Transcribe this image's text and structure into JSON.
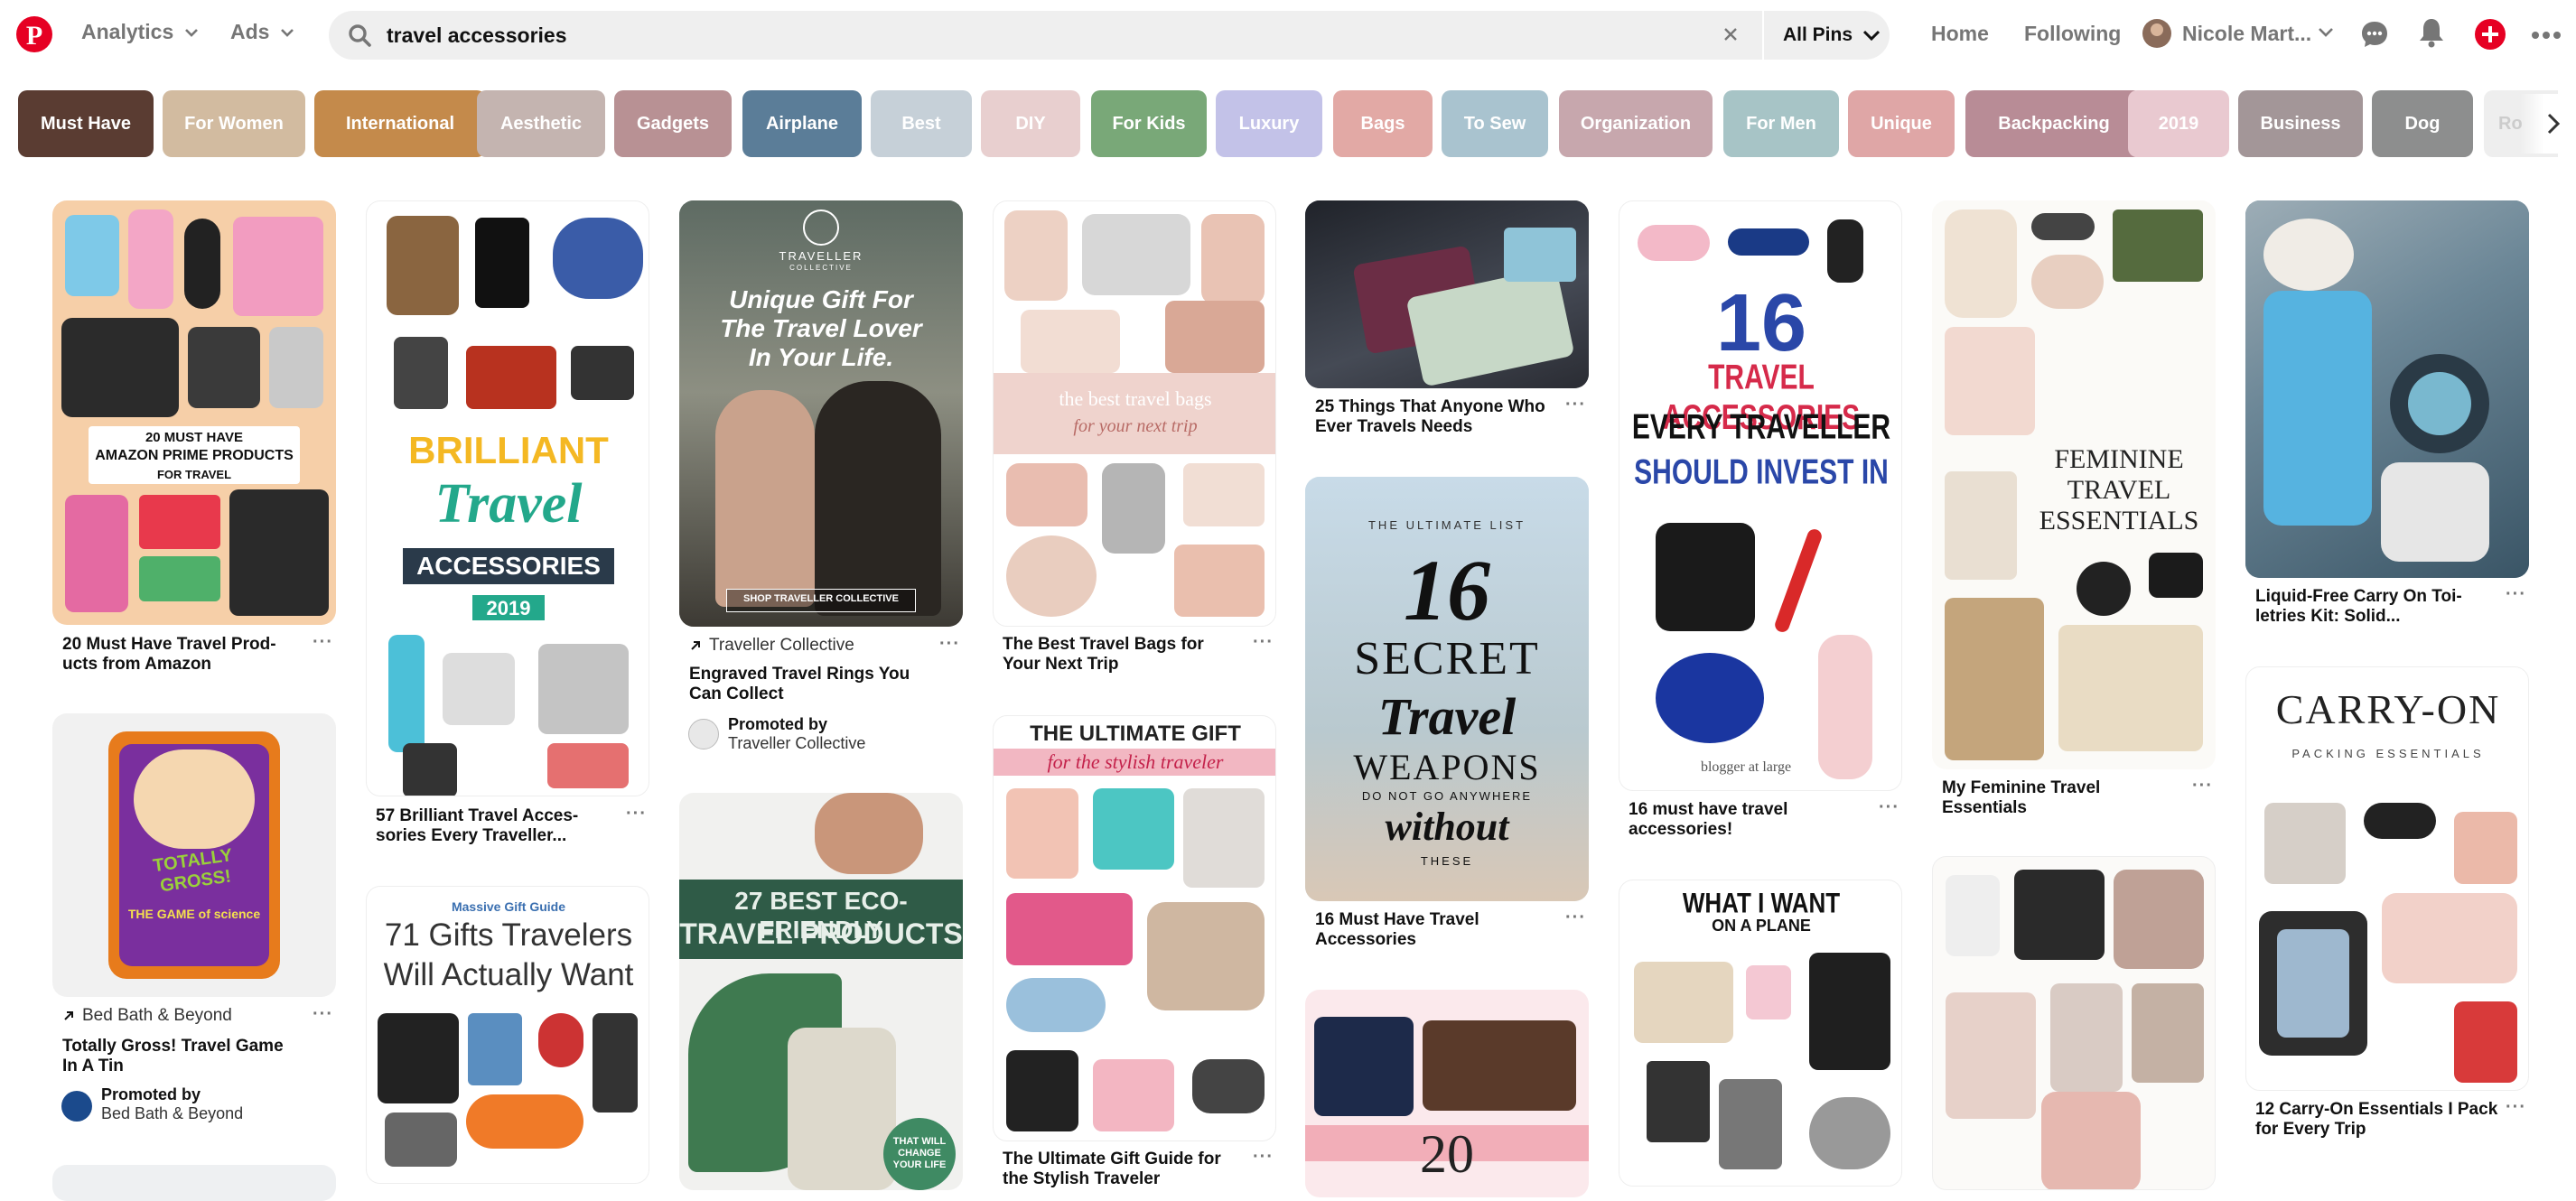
{
  "brand_color": "#e60023",
  "nav": {
    "analytics": "Analytics",
    "ads": "Ads"
  },
  "search": {
    "query": "travel accessories",
    "filter": "All Pins"
  },
  "top": {
    "home": "Home",
    "following": "Following",
    "user": "Nicole Mart..."
  },
  "chips": [
    {
      "label": "Must Have",
      "color": "#5a3c32"
    },
    {
      "label": "For Women",
      "color": "#d2bba0"
    },
    {
      "label": "International",
      "color": "#c48a4b"
    },
    {
      "label": "Aesthetic",
      "color": "#c4b4b0"
    },
    {
      "label": "Gadgets",
      "color": "#b89194"
    },
    {
      "label": "Airplane",
      "color": "#5b7d98"
    },
    {
      "label": "Best",
      "color": "#c6d0d8"
    },
    {
      "label": "DIY",
      "color": "#e8cfcf"
    },
    {
      "label": "For Kids",
      "color": "#79a878"
    },
    {
      "label": "Luxury",
      "color": "#c3c2e8"
    },
    {
      "label": "Bags",
      "color": "#e2a9a5"
    },
    {
      "label": "To Sew",
      "color": "#a9c3cf"
    },
    {
      "label": "Organization",
      "color": "#c7a7ad"
    },
    {
      "label": "For Men",
      "color": "#a7c4c6"
    },
    {
      "label": "Unique",
      "color": "#dfa6a6"
    },
    {
      "label": "Backpacking",
      "color": "#b88c96"
    },
    {
      "label": "2019",
      "color": "#e9c9d0"
    },
    {
      "label": "Business",
      "color": "#a39698"
    },
    {
      "label": "Dog",
      "color": "#8d8e8e"
    },
    {
      "label": "Ro",
      "color": "#eeeeee"
    }
  ],
  "pins": {
    "amazon": {
      "title": "20 Must Have Travel Prod- ucts from Amazon",
      "img_l1": "20 MUST HAVE",
      "img_l2": "AMAZON PRIME PRODUCTS",
      "img_l3": "FOR TRAVEL"
    },
    "game": {
      "source": "Bed Bath & Beyond",
      "title": "Totally Gross! Travel Game In A Tin",
      "promoted": "Promoted by",
      "advertiser": "Bed Bath & Beyond",
      "img_l1": "TOTALLY GROSS!",
      "img_l2": "THE GAME of science"
    },
    "brilliant": {
      "title": "57 Brilliant Travel Acces- sories Every Traveller...",
      "img_l1": "BRILLIANT",
      "img_l2": "Travel",
      "img_l3": "ACCESSORIES",
      "img_l4": "2019"
    },
    "gifts71": {
      "img_l0": "Massive Gift Guide",
      "img_l1": "71 Gifts Travelers",
      "img_l2": "Will Actually Want"
    },
    "rings": {
      "source": "Traveller Collective",
      "title": "Engraved Travel Rings You Can Collect",
      "promoted": "Promoted by",
      "advertiser": "Traveller Collective",
      "img_brand": "TRAVELLER",
      "img_sub": "COLLECTIVE",
      "img_l1": "Unique Gift For",
      "img_l2": "The Travel Lover",
      "img_l3": "In Your Life.",
      "img_btn": "SHOP TRAVELLER COLLECTIVE"
    },
    "eco": {
      "img_l1": "27 BEST ECO-FRIENDLY",
      "img_l2": "TRAVEL PRODUCTS",
      "img_badge": "THAT WILL CHANGE YOUR LIFE"
    },
    "bags": {
      "title": "The Best Travel Bags for Your Next Trip",
      "img_l1": "the best travel bags",
      "img_l2": "for your next trip"
    },
    "giftguide": {
      "title": "The Ultimate Gift Guide for the Stylish Traveler",
      "img_l1": "THE ULTIMATE GIFT GUIDE",
      "img_l2": "for the stylish traveler"
    },
    "things25": {
      "title": "25 Things That Anyone Who Ever Travels Needs"
    },
    "secret16": {
      "title": "16 Must Have Travel Accessories",
      "img_l0": "THE ULTIMATE LIST",
      "img_l1": "16",
      "img_l2": "SECRET",
      "img_l3": "Travel",
      "img_l4": "WEAPONS",
      "img_l5": "DO NOT GO ANYWHERE",
      "img_l6": "without",
      "img_l7": "THESE"
    },
    "twenty": {
      "img_l1": "20"
    },
    "every16": {
      "title": "16 must have travel accessories!",
      "img_l1": "16",
      "img_l2": "TRAVEL ACCESSORIES",
      "img_l3": "EVERY TRAVELLER",
      "img_l4": "SHOULD INVEST IN",
      "img_credit": "blogger at large"
    },
    "plane": {
      "img_l1": "WHAT I WANT",
      "img_l2": "ON A PLANE"
    },
    "feminine": {
      "title": "My Feminine Travel Essentials",
      "img_l1": "FEMININE",
      "img_l2": "TRAVEL",
      "img_l3": "ESSENTIALS"
    },
    "liquid": {
      "title": "Liquid-Free Carry On Toi- letries Kit: Solid..."
    },
    "carryon": {
      "title": "12 Carry-On Essentials I Pack for Every Trip",
      "img_l1": "CARRY-ON",
      "img_l2": "PACKING ESSENTIALS"
    }
  }
}
